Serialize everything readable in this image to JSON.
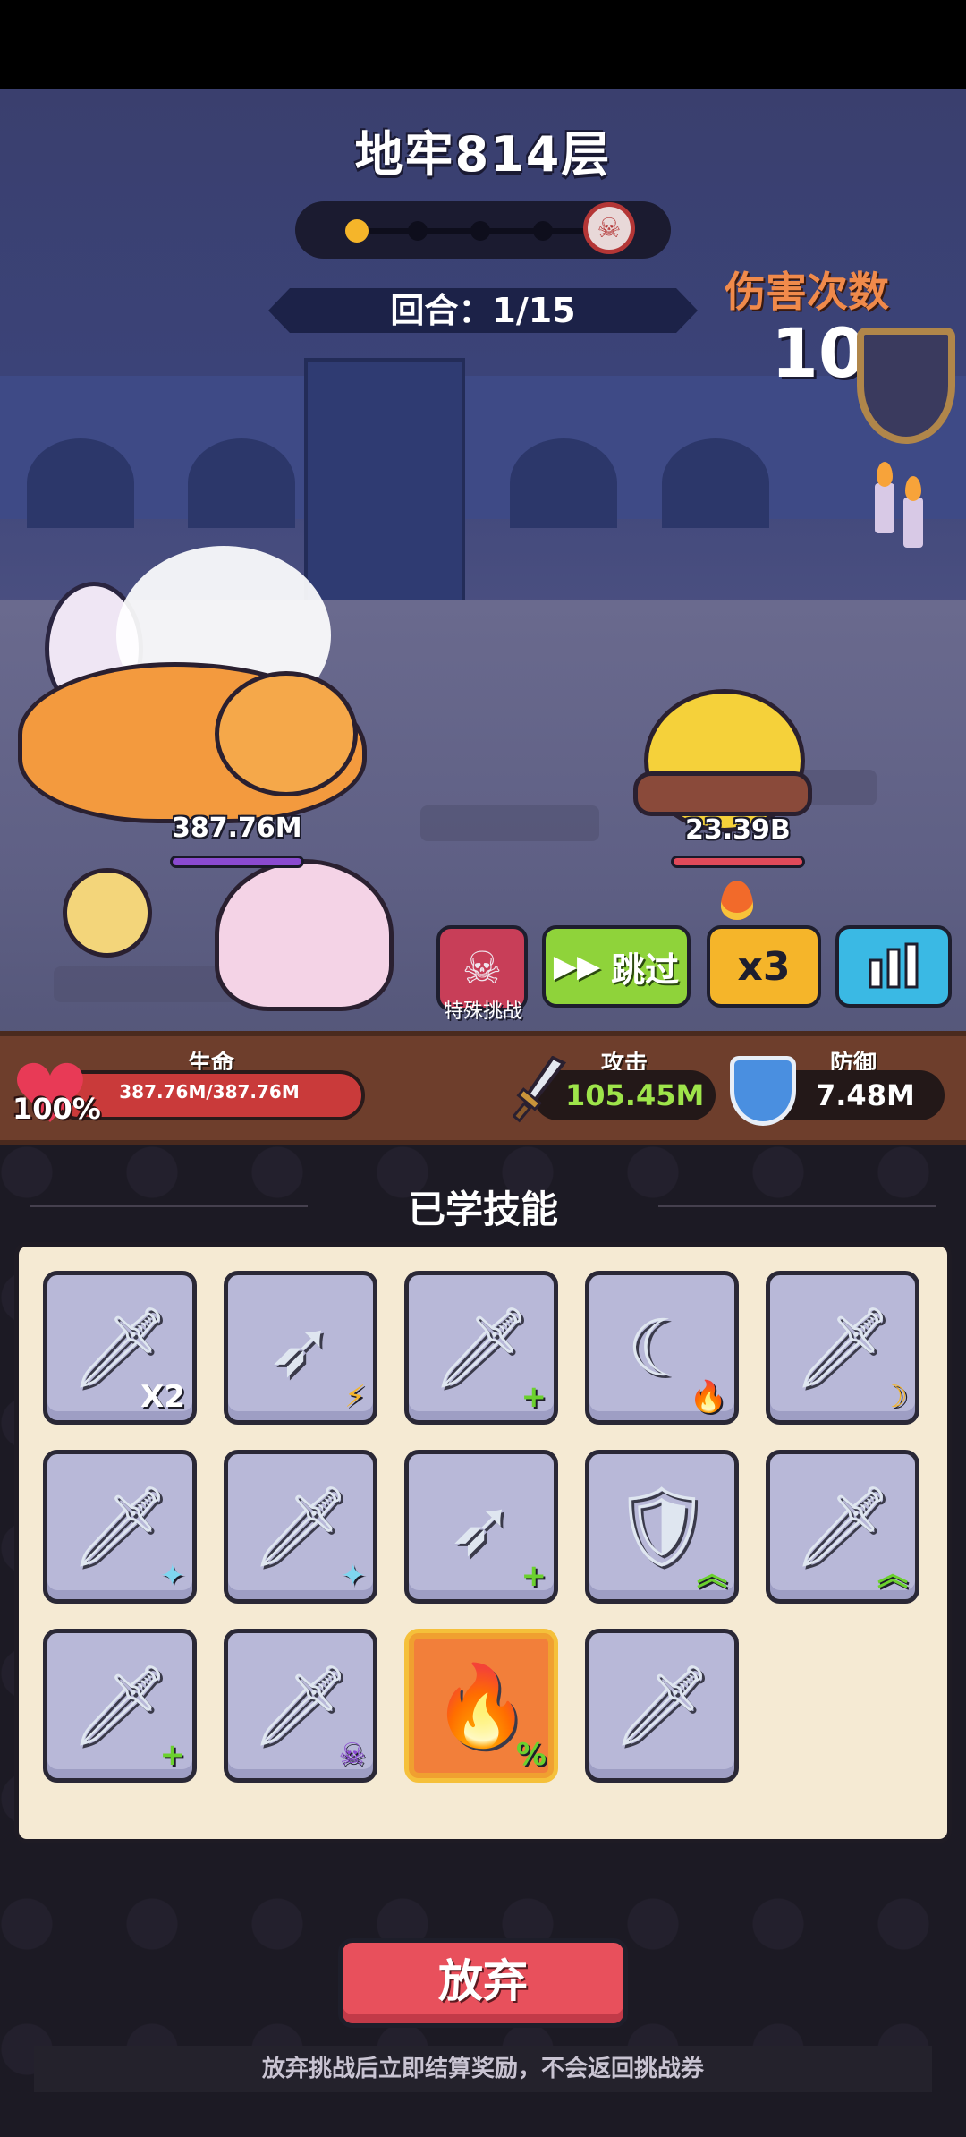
{
  "level_title": "地牢814层",
  "round": "回合：1/15",
  "damage_count_label": "伤害次数",
  "damage_count": "10",
  "player_hp_overhead": "387.76M",
  "enemy_hp_overhead": "23.39B",
  "buttons": {
    "special_challenge": "特殊挑战",
    "skip": "跳过",
    "speed": "x3"
  },
  "stats": {
    "hp_label": "生命",
    "hp_percent": "100%",
    "hp_value": "387.76M/387.76M",
    "attack_label": "攻击",
    "attack_value": "105.45M",
    "defense_label": "防御",
    "defense_value": "7.48M"
  },
  "skills_title": "已学技能",
  "skills": [
    {
      "icon": "sword-icon",
      "badge": "X2"
    },
    {
      "icon": "kunai-icon",
      "badge": "⚡"
    },
    {
      "icon": "flame-sword-icon",
      "badge": "+"
    },
    {
      "icon": "crescent-icon",
      "badge": "🔥"
    },
    {
      "icon": "flame-sword-icon",
      "badge": "☽"
    },
    {
      "icon": "flame-sword-icon",
      "badge": "✦"
    },
    {
      "icon": "sword-icon",
      "badge": "✦"
    },
    {
      "icon": "kunai-icon",
      "badge": "+"
    },
    {
      "icon": "shield-icon",
      "badge": "︽"
    },
    {
      "icon": "sword-icon",
      "badge": "︽"
    },
    {
      "icon": "sword-icon",
      "badge": "+"
    },
    {
      "icon": "sword-icon",
      "badge": "☠"
    },
    {
      "icon": "fire-icon",
      "badge": "%"
    },
    {
      "icon": "ice-sword-icon",
      "badge": ""
    }
  ],
  "abandon_button": "放弃",
  "footnote": "放弃挑战后立即结算奖励，不会返回挑战券"
}
